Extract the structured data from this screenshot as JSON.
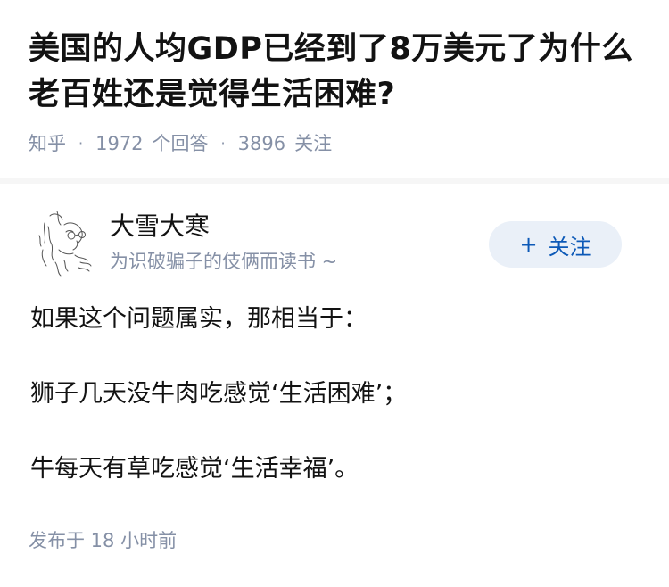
{
  "question": {
    "title": "美国的人均GDP已经到了8万美元了为什么老百姓还是觉得生活困难?",
    "source": "知乎",
    "answer_count": "1972",
    "answer_label": "个回答",
    "follower_count": "3896",
    "follower_label": "关注"
  },
  "answer": {
    "author_name": "大雪大寒",
    "author_bio": "为识破骗子的伎俩而读书 ~",
    "follow_plus": "+",
    "follow_label": "关注",
    "paragraphs": [
      "如果这个问题属实，那相当于：",
      "狮子几天没牛肉吃感觉‘生活困难’；",
      "牛每天有草吃感觉‘生活幸福’。"
    ],
    "publish_time": "发布于 18 小时前"
  },
  "icons": {
    "avatar": "sketch-avatar-icon"
  },
  "colors": {
    "accent": "#0c59b7",
    "follow_bg": "#eaf0f8",
    "meta_text": "#8590a6",
    "body_text": "#121212"
  }
}
